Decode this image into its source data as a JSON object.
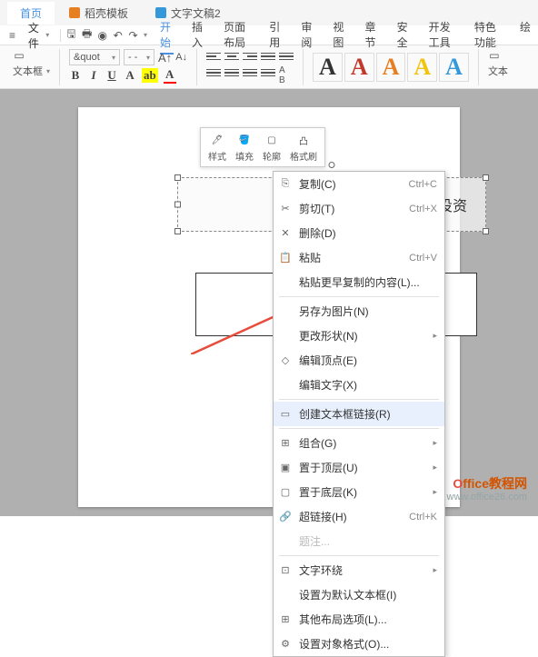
{
  "tabs": {
    "home": "首页",
    "template": "稻壳模板",
    "doc": "文字文稿2"
  },
  "menu": {
    "file": "文件"
  },
  "ribbon_tabs": [
    "开始",
    "插入",
    "页面布局",
    "引用",
    "审阅",
    "视图",
    "章节",
    "安全",
    "开发工具",
    "特色功能",
    "绘"
  ],
  "ribbon": {
    "textbox_label": "文本框",
    "font_placeholder": "&quot",
    "dash": "- -",
    "letter_a": "A",
    "text_label": "文本"
  },
  "float_tb": {
    "style": "样式",
    "fill": "填充",
    "outline": "轮廓",
    "format": "格式刷"
  },
  "doc_text": "\"战略投资",
  "ctx": {
    "copy": "复制(C)",
    "cut": "剪切(T)",
    "delete": "删除(D)",
    "paste": "粘贴",
    "paste_prev": "粘贴更早复制的内容(L)...",
    "save_img": "另存为图片(N)",
    "change_shape": "更改形状(N)",
    "edit_points": "编辑顶点(E)",
    "edit_text": "编辑文字(X)",
    "create_link": "创建文本框链接(R)",
    "group": "组合(G)",
    "bring_front": "置于顶层(U)",
    "send_back": "置于底层(K)",
    "hyperlink": "超链接(H)",
    "note": "题注...",
    "wrap": "文字环绕",
    "default_tb": "设置为默认文本框(I)",
    "layout_opts": "其他布局选项(L)...",
    "format_obj": "设置对象格式(O)...",
    "sc_copy": "Ctrl+C",
    "sc_cut": "Ctrl+X",
    "sc_paste": "Ctrl+V",
    "sc_link": "Ctrl+K"
  },
  "watermark": {
    "title": "Office教程网",
    "url": "www.office26.com"
  }
}
